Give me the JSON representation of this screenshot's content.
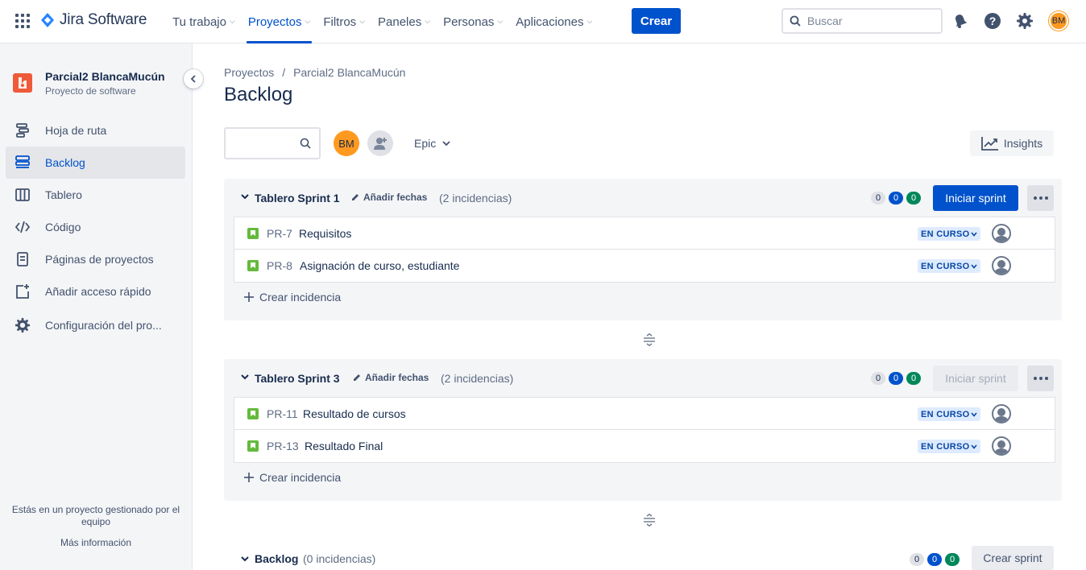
{
  "topnav": {
    "brand": "Jira Software",
    "items": [
      {
        "label": "Tu trabajo",
        "active": false
      },
      {
        "label": "Proyectos",
        "active": true
      },
      {
        "label": "Filtros",
        "active": false
      },
      {
        "label": "Paneles",
        "active": false
      },
      {
        "label": "Personas",
        "active": false
      },
      {
        "label": "Aplicaciones",
        "active": false
      }
    ],
    "create_label": "Crear",
    "search_placeholder": "Buscar",
    "avatar_initials": "BM",
    "icons": [
      "app-switcher-icon",
      "jira-logo-icon",
      "notifications-icon",
      "help-icon",
      "settings-icon"
    ]
  },
  "sidebar": {
    "project_name": "Parcial2 BlancaMucún",
    "project_type": "Proyecto de software",
    "items": [
      {
        "label": "Hoja de ruta",
        "icon": "roadmap-icon",
        "active": false
      },
      {
        "label": "Backlog",
        "icon": "backlog-icon",
        "active": true
      },
      {
        "label": "Tablero",
        "icon": "board-icon",
        "active": false
      },
      {
        "label": "Código",
        "icon": "code-icon",
        "active": false
      },
      {
        "label": "Páginas de proyectos",
        "icon": "pages-icon",
        "active": false
      },
      {
        "label": "Añadir acceso rápido",
        "icon": "add-shortcut-icon",
        "active": false
      },
      {
        "label": "Configuración del pro...",
        "icon": "gear-icon",
        "active": false
      }
    ],
    "footer_text": "Estás en un proyecto gestionado por el equipo",
    "footer_link": "Más información"
  },
  "main": {
    "breadcrumbs": [
      "Proyectos",
      "/",
      "Parcial2 BlancaMucún"
    ],
    "title": "Backlog",
    "toolbar": {
      "avatar_initials": "BM",
      "epic_label": "Epic",
      "insights_label": "Insights"
    },
    "sprints": [
      {
        "name": "Tablero Sprint 1",
        "dates_label": "Añadir fechas",
        "count_label": "(2 incidencias)",
        "pills": [
          "0",
          "0",
          "0"
        ],
        "start_label": "Iniciar sprint",
        "start_enabled": true,
        "issues": [
          {
            "key": "PR-7",
            "summary": "Requisitos",
            "status": "EN CURSO"
          },
          {
            "key": "PR-8",
            "summary": "Asignación de curso, estudiante",
            "status": "EN CURSO"
          }
        ],
        "create_label": "Crear incidencia"
      },
      {
        "name": "Tablero Sprint 3",
        "dates_label": "Añadir fechas",
        "count_label": "(2 incidencias)",
        "pills": [
          "0",
          "0",
          "0"
        ],
        "start_label": "Iniciar sprint",
        "start_enabled": false,
        "issues": [
          {
            "key": "PR-11",
            "summary": "Resultado de cursos",
            "status": "EN CURSO"
          },
          {
            "key": "PR-13",
            "summary": "Resultado Final",
            "status": "EN CURSO"
          }
        ],
        "create_label": "Crear incidencia"
      }
    ],
    "backlog": {
      "name": "Backlog",
      "count_label": "(0 incidencias)",
      "pills": [
        "0",
        "0",
        "0"
      ],
      "create_sprint_label": "Crear sprint"
    }
  },
  "colors": {
    "primary": "#0052cc",
    "avatar": "#ff991f",
    "status_bg": "#deebff",
    "story": "#63ba3c",
    "project_icon": "#ef5a3a"
  }
}
